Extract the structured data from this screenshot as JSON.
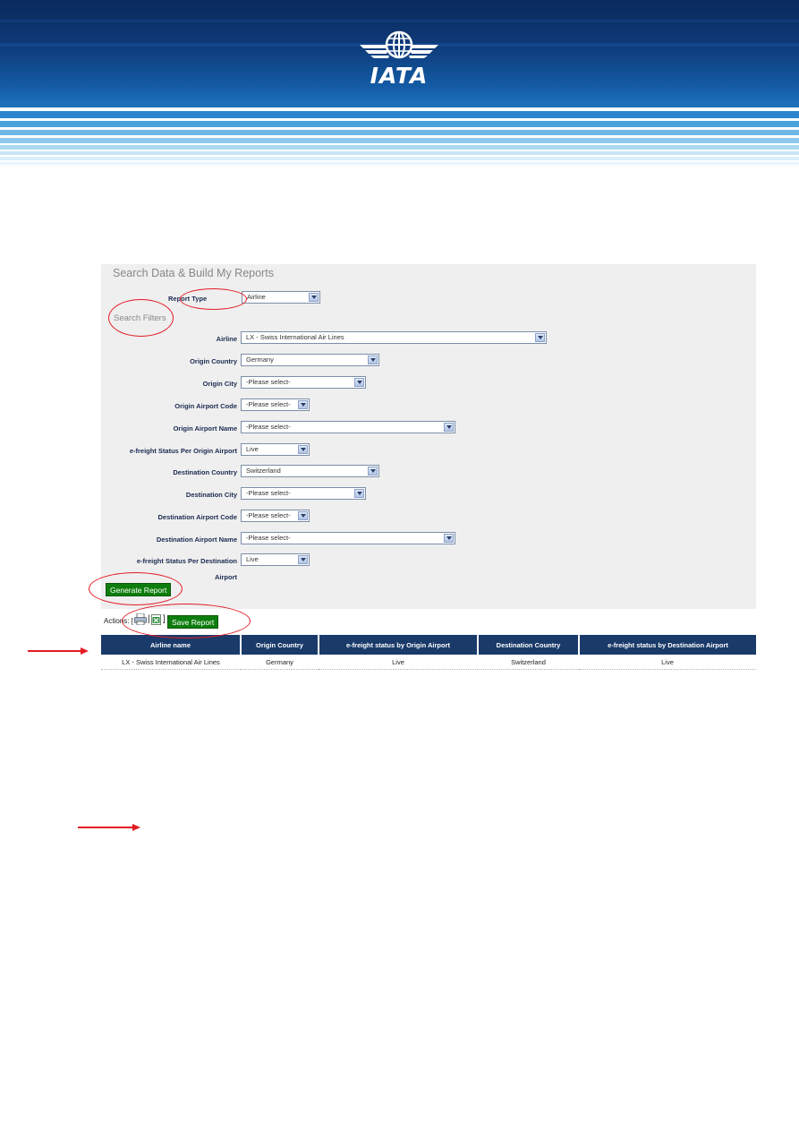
{
  "header": {
    "logo_text": "IATA",
    "logo_name": "iata-logo"
  },
  "panel": {
    "title": "Search Data & Build My Reports",
    "report_type_label": "Report Type",
    "report_type_value": "Airline",
    "filters_label": "Search Filters",
    "fields": [
      {
        "label": "Airline",
        "value": "LX - Swiss International Air Lines"
      },
      {
        "label": "Origin Country",
        "value": "Germany"
      },
      {
        "label": "Origin City",
        "value": "-Please select-"
      },
      {
        "label": "Origin Airport Code",
        "value": "-Please select-"
      },
      {
        "label": "Origin Airport Name",
        "value": "-Please select-"
      },
      {
        "label": "e-freight Status Per Origin Airport",
        "value": "Live"
      },
      {
        "label": "Destination Country",
        "value": "Switzerland"
      },
      {
        "label": "Destination City",
        "value": "-Please select-"
      },
      {
        "label": "Destination Airport Code",
        "value": "-Please select-"
      },
      {
        "label": "Destination Airport Name",
        "value": "-Please select-"
      },
      {
        "label": "e-freight Status Per Destination",
        "value": "Live"
      }
    ],
    "destination_status_label_line2": "Airport",
    "generate_button": "Generate Report"
  },
  "actions": {
    "label": "Actions: [",
    "separator": "|",
    "close": "]",
    "save_button": "Save Report",
    "print_icon": "print-icon",
    "excel_icon": "excel-icon"
  },
  "table": {
    "headers": [
      "Airline name",
      "Origin Country",
      "e-freight status by Origin Airport",
      "Destination Country",
      "e-freight status by Destination Airport"
    ],
    "rows": [
      [
        "LX - Swiss International Air Lines",
        "Germany",
        "Live",
        "Switzerland",
        "Live"
      ]
    ]
  },
  "colors": {
    "banner_dark": "#0b2f63",
    "banner_mid": "#1e6db3",
    "table_header": "#1a3a6a",
    "button_green": "#0d7d0d",
    "annotation_red": "#e31b23"
  }
}
